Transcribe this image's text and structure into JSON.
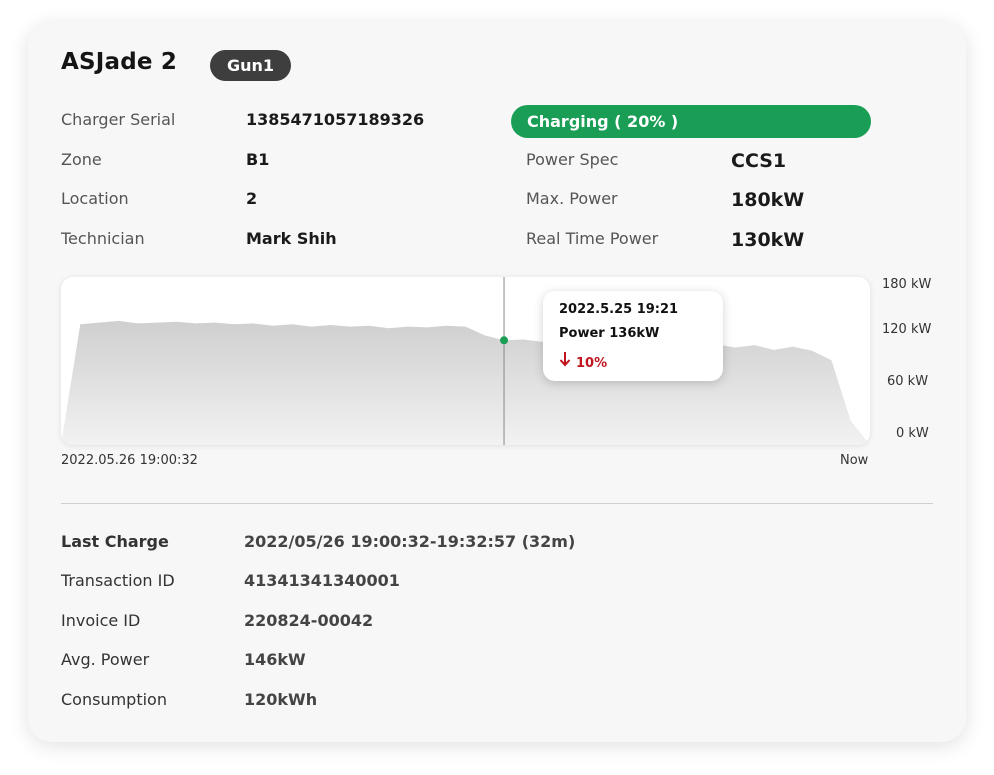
{
  "header": {
    "title": "ASJade 2",
    "gun_label": "Gun1"
  },
  "info_left": [
    {
      "label": "Charger Serial",
      "value": "1385471057189326"
    },
    {
      "label": "Zone",
      "value": "B1"
    },
    {
      "label": "Location",
      "value": "2"
    },
    {
      "label": "Technician",
      "value": "Mark Shih"
    }
  ],
  "status": {
    "label": "Charging ( 20% )",
    "percent": 20,
    "color": "#1a9e55"
  },
  "info_right": [
    {
      "label": "Power Spec",
      "value": "CCS1"
    },
    {
      "label": "Max. Power",
      "value": "180kW"
    },
    {
      "label": "Real Time Power",
      "value": "130kW"
    }
  ],
  "chart_data": {
    "type": "area",
    "x_start_label": "2022.05.26 19:00:32",
    "x_end_label": "Now",
    "y_ticks": [
      "180 kW",
      "120 kW",
      "60 kW",
      "0 kW"
    ],
    "ylim": [
      0,
      180
    ],
    "series": [
      {
        "values": [
          0,
          150,
          152,
          154,
          151,
          152,
          153,
          151,
          152,
          150,
          151,
          148,
          150,
          147,
          149,
          147,
          148,
          145,
          147,
          146,
          148,
          147,
          136,
          130,
          131,
          128,
          129,
          128,
          127,
          126,
          128,
          124,
          127,
          122,
          125,
          121,
          124,
          118,
          122,
          117,
          105,
          30,
          0
        ]
      }
    ],
    "tooltip": {
      "date": "2022.5.25 19:21",
      "power_label": "Power 136kW",
      "change_label": "10%",
      "direction": "down"
    }
  },
  "last_charge": [
    {
      "label": "Last Charge",
      "value": "2022/05/26 19:00:32-19:32:57 (32m)"
    },
    {
      "label": "Transaction ID",
      "value": "41341341340001"
    },
    {
      "label": "Invoice ID",
      "value": "220824-00042"
    },
    {
      "label": "Avg. Power",
      "value": "146kW"
    },
    {
      "label": "Consumption",
      "value": "120kWh"
    }
  ],
  "colors": {
    "accent": "#1a9e55",
    "negative": "#c0141e",
    "area_top": "#cfcfcf",
    "area_bottom": "#f2f2f2"
  }
}
